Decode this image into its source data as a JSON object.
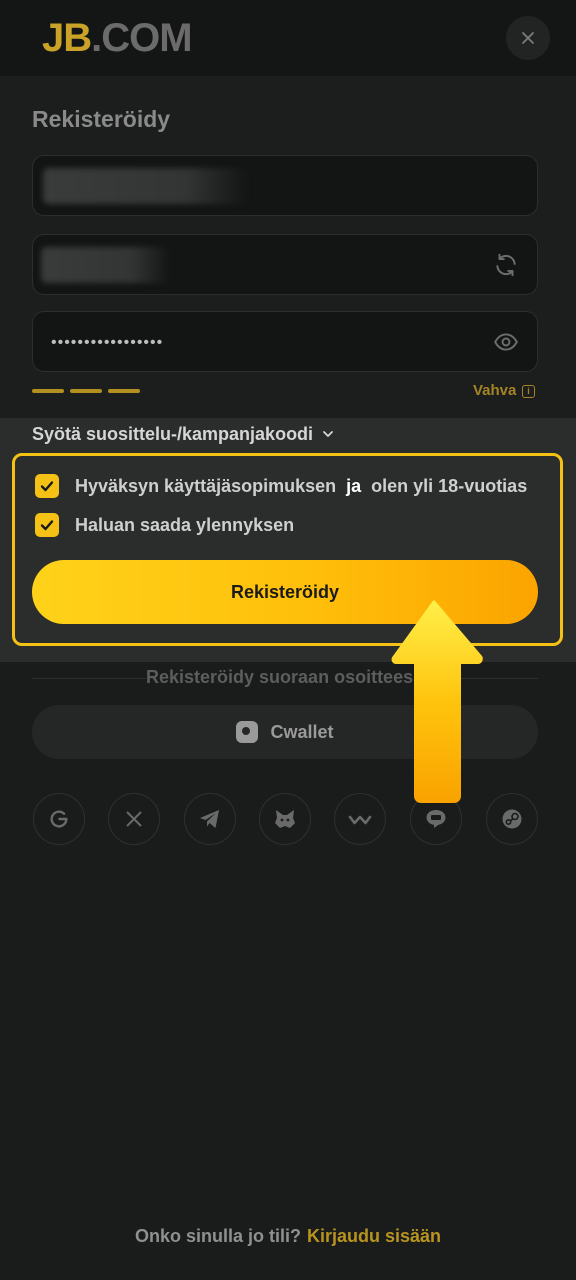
{
  "header": {
    "logo_primary": "JB",
    "logo_secondary": ".COM",
    "close_icon": "close-icon"
  },
  "form": {
    "title": "Rekisteröidy",
    "password_masked": "•••••••••••••••••",
    "strength_label": "Vahva",
    "strength_icon": "info-icon",
    "refresh_icon": "refresh-icon",
    "eye_icon": "eye-icon"
  },
  "promo": {
    "link_label": "Syötä suosittelu-/kampanjakoodi",
    "chevron_icon": "chevron-down-icon"
  },
  "consents": {
    "terms_before": "Hyväksyn käyttäjäsopimuksen",
    "terms_link": "ja",
    "terms_after": "olen yli 18-vuotias",
    "terms_checked": true,
    "promo_label": "Haluan saada ylennyksen",
    "promo_checked": true
  },
  "register_button": "Rekisteröidy",
  "direct": {
    "divider_text": "Rekisteröidy suoraan osoitteess",
    "cwallet_label": "Cwallet"
  },
  "social_icons": [
    "google-icon",
    "x-icon",
    "telegram-icon",
    "metamask-icon",
    "walletconnect-icon",
    "line-icon",
    "steam-icon"
  ],
  "footer": {
    "question": "Onko sinulla jo tili?",
    "login_link": "Kirjaudu sisään"
  },
  "colors": {
    "accent": "#f5c114",
    "background": "#1a1b1b",
    "button_gradient_start": "#ffd21a",
    "button_gradient_end": "#fca400"
  }
}
